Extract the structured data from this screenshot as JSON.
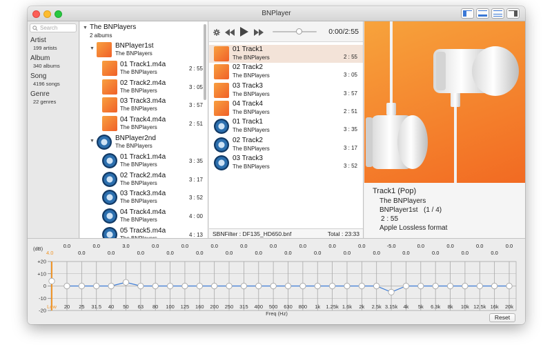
{
  "window": {
    "title": "BNPlayer"
  },
  "view_buttons": [
    "layout-left-icon",
    "layout-bottom-icon",
    "layout-split-icon",
    "layout-right-icon"
  ],
  "search": {
    "placeholder": "Search"
  },
  "categories": [
    {
      "name": "Artist",
      "count": "199 artists"
    },
    {
      "name": "Album",
      "count": "340 albums"
    },
    {
      "name": "Song",
      "count": "4196 songs"
    },
    {
      "name": "Genre",
      "count": "22 genres"
    }
  ],
  "tree": {
    "artist": "The BNPlayers",
    "artist_sub": "2 albums",
    "albums": [
      {
        "title": "BNPlayer1st",
        "artist": "The BNPlayers",
        "art": "orange",
        "tracks": [
          {
            "title": "01 Track1.m4a",
            "artist": "The BNPlayers",
            "dur": "2 : 55"
          },
          {
            "title": "02 Track2.m4a",
            "artist": "The BNPlayers",
            "dur": "3 : 05"
          },
          {
            "title": "03 Track3.m4a",
            "artist": "The BNPlayers",
            "dur": "3 : 57"
          },
          {
            "title": "04 Track4.m4a",
            "artist": "The BNPlayers",
            "dur": "2 : 51"
          }
        ]
      },
      {
        "title": "BNPlayer2nd",
        "artist": "The BNPlayers",
        "art": "blue",
        "tracks": [
          {
            "title": "01 Track1.m4a",
            "artist": "The BNPlayers",
            "dur": "3 : 35"
          },
          {
            "title": "02 Track2.m4a",
            "artist": "The BNPlayers",
            "dur": "3 : 17"
          },
          {
            "title": "03 Track3.m4a",
            "artist": "The BNPlayers",
            "dur": "3 : 52"
          },
          {
            "title": "04 Track4.m4a",
            "artist": "The BNPlayers",
            "dur": "4 : 00"
          },
          {
            "title": "05 Track5.m4a",
            "artist": "The BNPlayers",
            "dur": "4 : 13"
          }
        ]
      }
    ]
  },
  "player": {
    "time": "0:00/2:55",
    "progress": 0.6,
    "controls": [
      "gear-icon",
      "rewind-icon",
      "play-icon",
      "fast-forward-icon"
    ]
  },
  "playlist": [
    {
      "title": "01 Track1",
      "artist": "The BNPlayers",
      "dur": "2 : 55",
      "art": "orange",
      "selected": true
    },
    {
      "title": "02 Track2",
      "artist": "The BNPlayers",
      "dur": "3 : 05",
      "art": "orange"
    },
    {
      "title": "03 Track3",
      "artist": "The BNPlayers",
      "dur": "3 : 57",
      "art": "orange"
    },
    {
      "title": "04 Track4",
      "artist": "The BNPlayers",
      "dur": "2 : 51",
      "art": "orange"
    },
    {
      "title": "01 Track1",
      "artist": "The BNPlayers",
      "dur": "3 : 35",
      "art": "blue"
    },
    {
      "title": "02 Track2",
      "artist": "The BNPlayers",
      "dur": "3 : 17",
      "art": "blue"
    },
    {
      "title": "03 Track3",
      "artist": "The BNPlayers",
      "dur": "3 : 52",
      "art": "blue"
    }
  ],
  "playlist_footer": {
    "filter": "SBNFilter : DF135_HD650.bnf",
    "total": "Total : 23:33"
  },
  "now_playing": {
    "title": "Track1 (Pop)",
    "artist": "The BNPlayers",
    "album": "BNPlayer1st",
    "track_pos": "(1 / 4)",
    "duration": "2 : 55",
    "format": "Apple Lossless format"
  },
  "eq": {
    "db_label": "(dB)",
    "preamp_value": "4.0",
    "y_labels": [
      "+20",
      "+10",
      "0",
      "-10",
      "-20"
    ],
    "freq_label": "Freq (Hz)",
    "reset_label": "Reset",
    "bands": [
      {
        "freq": "Low",
        "value": 4.0,
        "text": "4.0"
      },
      {
        "freq": "20",
        "value": 0.0,
        "text": "0.0"
      },
      {
        "freq": "25",
        "value": 0.0,
        "text": "0.0"
      },
      {
        "freq": "31.5",
        "value": 0.0,
        "text": "0.0"
      },
      {
        "freq": "40",
        "value": 0.0,
        "text": "0.0"
      },
      {
        "freq": "50",
        "value": 3.0,
        "text": "3.0"
      },
      {
        "freq": "63",
        "value": 0.0,
        "text": "0.0"
      },
      {
        "freq": "80",
        "value": 0.0,
        "text": "0.0"
      },
      {
        "freq": "100",
        "value": 0.0,
        "text": "0.0"
      },
      {
        "freq": "125",
        "value": 0.0,
        "text": "0.0"
      },
      {
        "freq": "160",
        "value": 0.0,
        "text": "0.0"
      },
      {
        "freq": "200",
        "value": 0.0,
        "text": "0.0"
      },
      {
        "freq": "250",
        "value": 0.0,
        "text": "0.0"
      },
      {
        "freq": "315",
        "value": 0.0,
        "text": "0.0"
      },
      {
        "freq": "400",
        "value": 0.0,
        "text": "0.0"
      },
      {
        "freq": "500",
        "value": 0.0,
        "text": "0.0"
      },
      {
        "freq": "630",
        "value": 0.0,
        "text": "0.0"
      },
      {
        "freq": "800",
        "value": 0.0,
        "text": "0.0"
      },
      {
        "freq": "1k",
        "value": 0.0,
        "text": "0.0"
      },
      {
        "freq": "1.25k",
        "value": 0.0,
        "text": "0.0"
      },
      {
        "freq": "1.6k",
        "value": 0.0,
        "text": "0.0"
      },
      {
        "freq": "2k",
        "value": 0.0,
        "text": "0.0"
      },
      {
        "freq": "2.5k",
        "value": 0.0,
        "text": "0.0"
      },
      {
        "freq": "3.15k",
        "value": -5.0,
        "text": "-5.0"
      },
      {
        "freq": "4k",
        "value": 0.0,
        "text": "0.0"
      },
      {
        "freq": "5k",
        "value": 0.0,
        "text": "0.0"
      },
      {
        "freq": "6.3k",
        "value": 0.0,
        "text": "0.0"
      },
      {
        "freq": "8k",
        "value": 0.0,
        "text": "0.0"
      },
      {
        "freq": "10k",
        "value": 0.0,
        "text": "0.0"
      },
      {
        "freq": "12.5k",
        "value": 0.0,
        "text": "0.0"
      },
      {
        "freq": "16k",
        "value": 0.0,
        "text": "0.0"
      },
      {
        "freq": "20k",
        "value": 0.0,
        "text": "0.0"
      }
    ],
    "colors": {
      "curve": "#3b7bd6",
      "preamp": "#f0962a",
      "low_label": "#f0962a"
    }
  }
}
